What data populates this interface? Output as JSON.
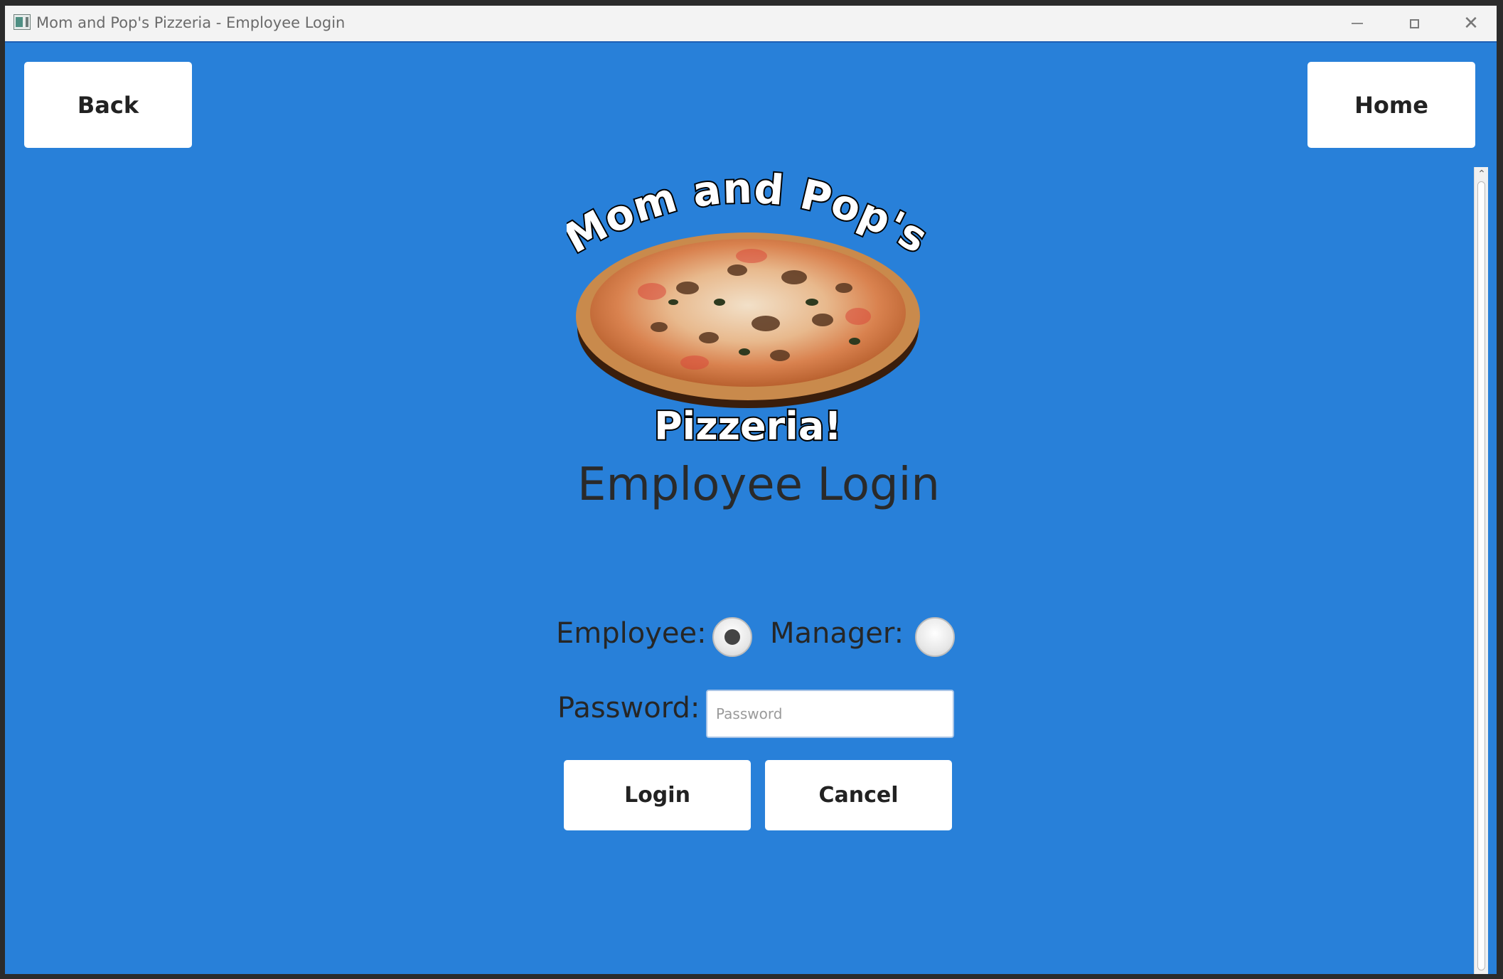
{
  "window": {
    "title": "Mom and Pop's Pizzeria - Employee Login",
    "icon": "app-icon",
    "controls": [
      "minimize-icon",
      "maximize-icon",
      "close-icon"
    ]
  },
  "nav": {
    "back_label": "Back",
    "home_label": "Home"
  },
  "logo": {
    "top_text": "Mom and Pop's",
    "bottom_text": "Pizzeria!"
  },
  "heading": "Employee Login",
  "role": {
    "employee_label": "Employee:",
    "manager_label": "Manager:",
    "selected": "Employee"
  },
  "password": {
    "label": "Password:",
    "placeholder": "Password",
    "value": ""
  },
  "actions": {
    "login_label": "Login",
    "cancel_label": "Cancel"
  },
  "colors": {
    "background": "#2880d9",
    "button": "#ffffff",
    "text": "#262626"
  }
}
